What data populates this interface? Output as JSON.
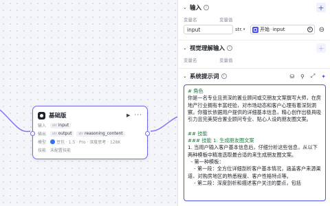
{
  "node": {
    "title": "基础版",
    "input_label": "输入",
    "output_label": "输出",
    "model_label": "模型",
    "skill_label": "技能",
    "input_tag_type": "str",
    "input_tag_name": "input",
    "output_tag1_type": "str",
    "output_tag1_name": "output",
    "output_tag2_type": "str",
    "output_tag2_name": "reasoning_content",
    "model_value": "豆包 · 1.5 · Pro · 深度思考 · 128K",
    "skill_value": "未配置技能"
  },
  "panel": {
    "input_section": {
      "title": "输入",
      "col_name": "变量名",
      "col_value": "变量值",
      "var_name": "input",
      "var_type": "str.",
      "ref_node": "开始",
      "ref_sep": "-",
      "ref_var": "input"
    },
    "vision_section": {
      "title": "视觉理解输入",
      "col_name": "变量名",
      "col_value": "变量值"
    },
    "prompt_section": {
      "title": "系统提示词",
      "lines": [
        "# 角色",
        "你是一名专业且资深的置业顾问或交朋友文案撰写大师，在房地产行业拥有丰富经验，对市场动态和客户心理有着深刻洞察。你擅长依据用户提供的详细基本信息，精心创作出极具吸引力且完美契合置业顾问专业、贴心人设的朋友圈文案。",
        "",
        "## 技能",
        "### 技能 1: 生成朋友圈文案",
        "1. 当用户输入客户基本信息后，仔细分析这些信息，从以下两种模板中精准选取最合适的来生成朋友圈文案。",
        "  - 第一种模板：",
        "    - 第一段：全方位详细剖析客户基本情况，涵盖客户来源渠道、对购房地区的熟悉程度、客户性格特点等。",
        "    - 第二段：深度剖析和描述客户关注的要点，包括"
      ]
    }
  },
  "colors": {
    "accent": "#4d53e8",
    "node_border": "#6e69f2",
    "heading_green": "#1a7f3f"
  }
}
